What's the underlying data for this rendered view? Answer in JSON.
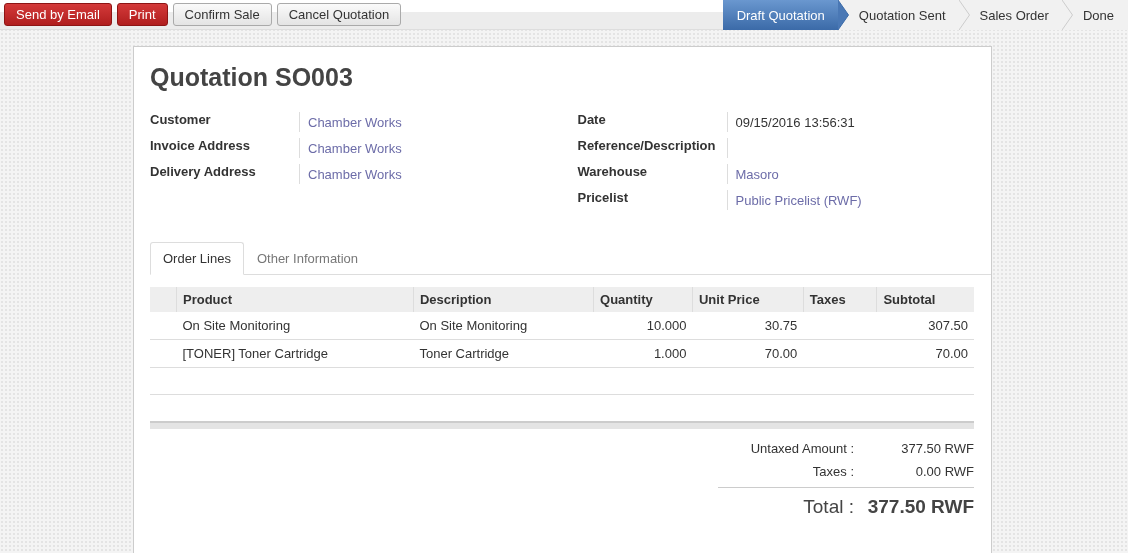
{
  "actions": [
    {
      "label": "Send by Email",
      "kind": "primary"
    },
    {
      "label": "Print",
      "kind": "primary"
    },
    {
      "label": "Confirm Sale",
      "kind": "default"
    },
    {
      "label": "Cancel Quotation",
      "kind": "default"
    }
  ],
  "status_steps": [
    {
      "label": "Draft Quotation",
      "selected": true
    },
    {
      "label": "Quotation Sent",
      "selected": false
    },
    {
      "label": "Sales Order",
      "selected": false
    },
    {
      "label": "Done",
      "selected": false
    }
  ],
  "title": {
    "prefix": "Quotation",
    "number": "SO003"
  },
  "left_fields": [
    {
      "label": "Customer",
      "value": "Chamber Works",
      "kind": "link"
    },
    {
      "label": "Invoice Address",
      "value": "Chamber Works",
      "kind": "link"
    },
    {
      "label": "Delivery Address",
      "value": "Chamber Works",
      "kind": "link"
    }
  ],
  "right_fields": [
    {
      "label": "Date",
      "value": "09/15/2016 13:56:31",
      "kind": "text"
    },
    {
      "label": "Reference/Description"
    },
    {
      "label": "Warehouse",
      "value": "Masoro",
      "kind": "link"
    },
    {
      "label": "Pricelist",
      "value": "Public Pricelist (RWF)",
      "kind": "link"
    }
  ],
  "tabs": [
    {
      "label": "Order Lines",
      "selected": true
    },
    {
      "label": "Other Information",
      "selected": false
    }
  ],
  "table": {
    "columns": [
      {
        "label": "Product",
        "numeric": false
      },
      {
        "label": "Description",
        "numeric": false
      },
      {
        "label": "Quantity",
        "numeric": true
      },
      {
        "label": "Unit Price",
        "numeric": true
      },
      {
        "label": "Taxes"
      },
      {
        "label": "Subtotal",
        "numeric": true
      }
    ],
    "rows": [
      [
        "On Site Monitoring",
        "On Site Monitoring",
        "10.000",
        "30.75",
        "",
        "307.50"
      ],
      [
        "[TONER] Toner Cartridge",
        "Toner Cartridge",
        "1.000",
        "70.00",
        "",
        "70.00"
      ]
    ]
  },
  "totals": [
    {
      "label": "Untaxed Amount :",
      "value": "377.50 RWF"
    },
    {
      "label": "Taxes :",
      "value": "0.00 RWF"
    }
  ],
  "grand_total": {
    "label": "Total :",
    "value": "377.50 RWF"
  }
}
